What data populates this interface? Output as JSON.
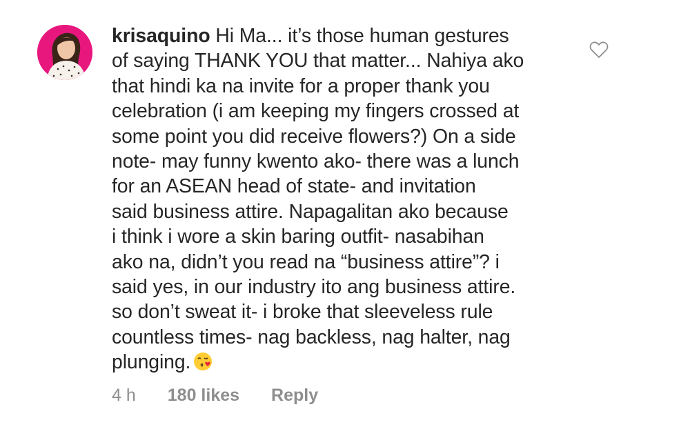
{
  "comment": {
    "username": "krisaquino",
    "text": "Hi Ma... it’s those human gestures\nof saying THANK YOU that matter... Nahiya ako\nthat hindi ka na invite for a proper thank you\ncelebration (i am keeping my fingers crossed at\nsome point you did receive flowers?) On a side\nnote- may funny kwento ako- there was a lunch\nfor an ASEAN head of state- and invitation\nsaid business attire. Napagalitan ako because\ni think i wore a skin baring outfit- nasabihan\nako na, didn’t you read na “business attire”? i\nsaid yes, in our industry ito ang business attire.\nso don’t sweat it- i broke that sleeveless rule\ncountless times- nag backless, nag halter, nag\nplunging.",
    "emoji": "kissing-face-emoji",
    "time": "4 h",
    "likes": "180 likes",
    "reply_label": "Reply",
    "like_icon": "heart-outline-icon",
    "colors": {
      "avatar_bg": "#e8177e",
      "text": "#262626",
      "meta": "#8e8e8e"
    }
  }
}
